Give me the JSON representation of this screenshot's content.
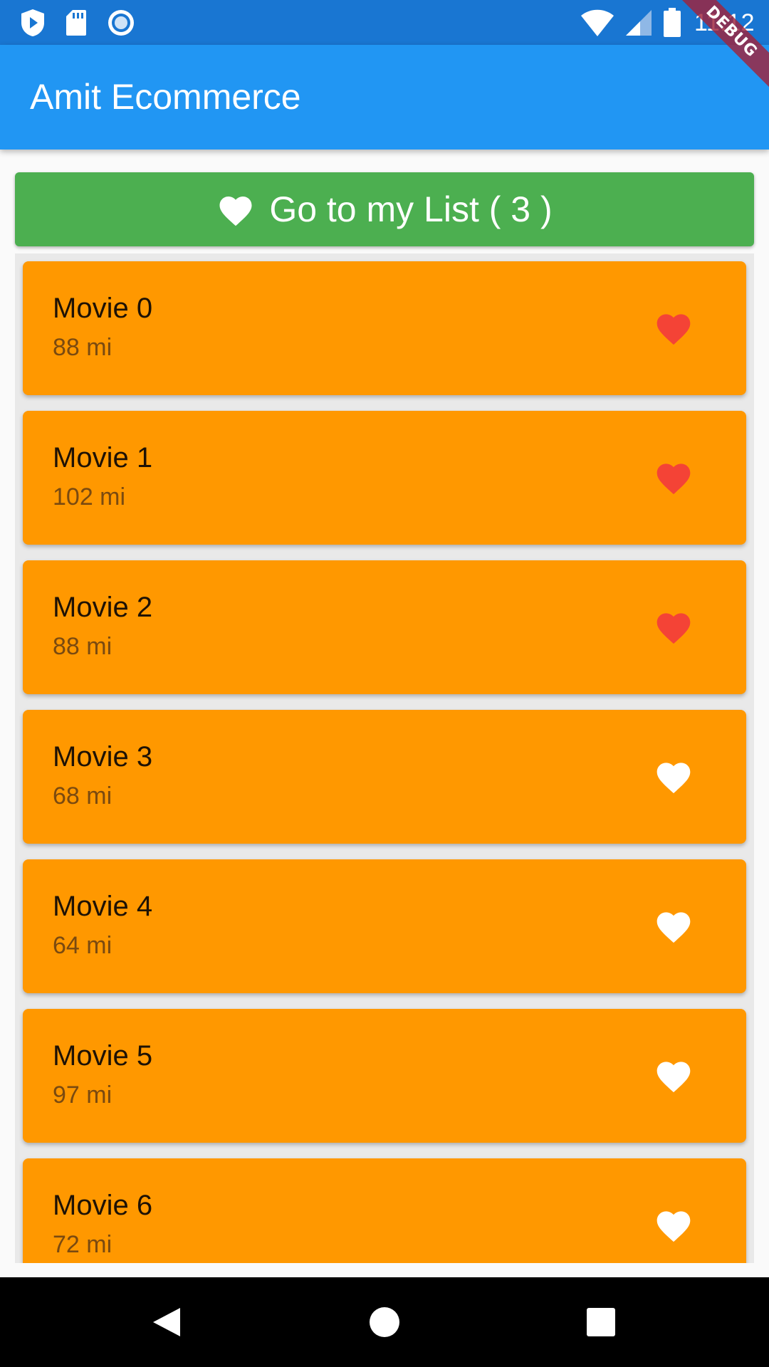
{
  "status_bar": {
    "time": "11:12",
    "left_icons": [
      "play-protect-icon",
      "sd-card-icon",
      "record-icon"
    ],
    "right_icons": [
      "wifi-icon",
      "cellular-signal-icon",
      "battery-icon"
    ]
  },
  "debug_banner": "DEBUG",
  "app_bar": {
    "title": "Amit Ecommerce"
  },
  "my_list_button": {
    "label": "Go to my List ( 3 )",
    "icon": "heart-icon"
  },
  "movies": [
    {
      "title": "Movie 0",
      "distance": "88 mi",
      "favorite": true
    },
    {
      "title": "Movie 1",
      "distance": "102 mi",
      "favorite": true
    },
    {
      "title": "Movie 2",
      "distance": "88 mi",
      "favorite": true
    },
    {
      "title": "Movie 3",
      "distance": "68 mi",
      "favorite": false
    },
    {
      "title": "Movie 4",
      "distance": "64 mi",
      "favorite": false
    },
    {
      "title": "Movie 5",
      "distance": "97 mi",
      "favorite": false
    },
    {
      "title": "Movie 6",
      "distance": "72 mi",
      "favorite": false
    }
  ],
  "colors": {
    "status_bar": "#1976d2",
    "app_bar": "#2196f3",
    "button": "#4caf50",
    "card": "#ff9800",
    "favorite_heart": "#f44336",
    "unfavorite_heart": "#ffffff"
  },
  "nav_bar": {
    "buttons": [
      "back-icon",
      "home-icon",
      "recents-icon"
    ]
  }
}
